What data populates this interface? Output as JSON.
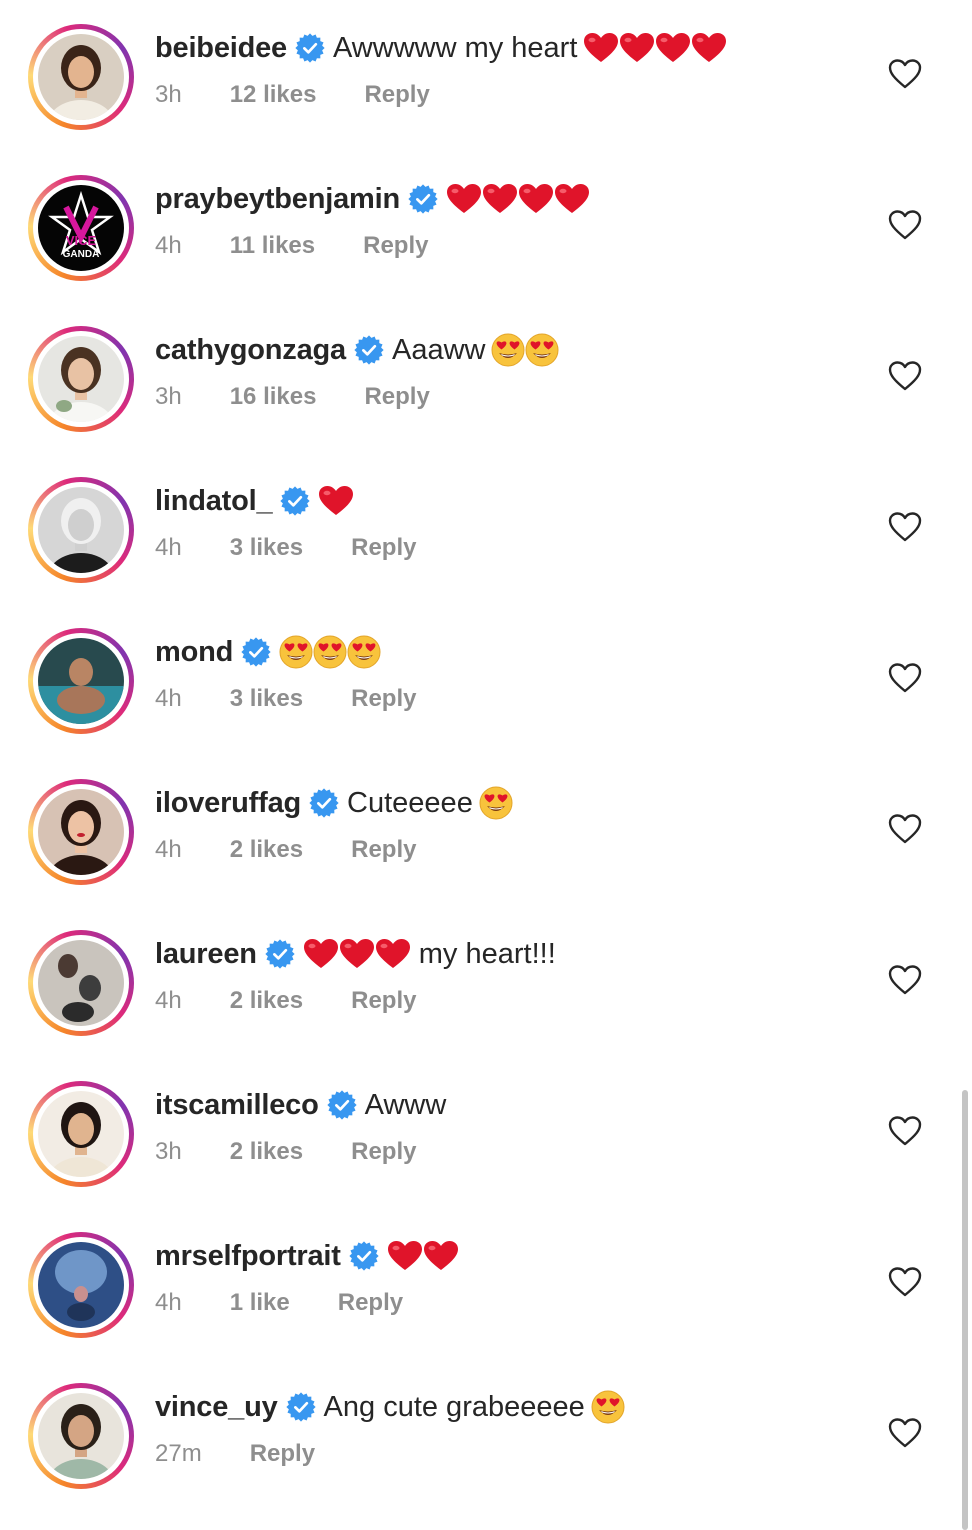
{
  "colors": {
    "username": "#262626",
    "meta": "#8e8e8e",
    "verified": "#3897f0",
    "heart_emoji": "#e0142a",
    "face_emoji": "#f8c33c"
  },
  "comments": [
    {
      "username": "beibeidee",
      "verified": true,
      "text_before": "Awwwww my heart",
      "emojis": [
        "heart",
        "heart",
        "heart",
        "heart"
      ],
      "text_after": "",
      "time": "3h",
      "likes": "12 likes",
      "reply": "Reply",
      "avatar": "portrait-woman-white-dress"
    },
    {
      "username": "praybeytbenjamin",
      "verified": true,
      "text_before": "",
      "emojis": [
        "heart",
        "heart",
        "heart",
        "heart"
      ],
      "text_after": "",
      "time": "4h",
      "likes": "11 likes",
      "reply": "Reply",
      "avatar": "vice-ganda-logo",
      "avatar_text": [
        "VICE",
        "GANDA"
      ]
    },
    {
      "username": "cathygonzaga",
      "verified": true,
      "text_before": "Aaaww",
      "emojis": [
        "heart-eyes",
        "heart-eyes"
      ],
      "text_after": "",
      "time": "3h",
      "likes": "16 likes",
      "reply": "Reply",
      "avatar": "portrait-bride"
    },
    {
      "username": "lindatol_",
      "verified": true,
      "text_before": "",
      "emojis": [
        "heart"
      ],
      "text_after": "",
      "time": "4h",
      "likes": "3 likes",
      "reply": "Reply",
      "avatar": "portrait-woman-black-white"
    },
    {
      "username": "mond",
      "verified": true,
      "text_before": "",
      "emojis": [
        "heart-eyes",
        "heart-eyes",
        "heart-eyes"
      ],
      "text_after": "",
      "time": "4h",
      "likes": "3 likes",
      "reply": "Reply",
      "avatar": "portrait-man-pool"
    },
    {
      "username": "iloveruffag",
      "verified": true,
      "text_before": "Cuteeeee",
      "emojis": [
        "heart-eyes"
      ],
      "text_after": "",
      "time": "4h",
      "likes": "2 likes",
      "reply": "Reply",
      "avatar": "portrait-woman-red-lips"
    },
    {
      "username": "laureen",
      "verified": true,
      "text_before": "",
      "emojis": [
        "heart",
        "heart",
        "heart"
      ],
      "text_after": "my heart!!!",
      "time": "4h",
      "likes": "2 likes",
      "reply": "Reply",
      "avatar": "portrait-collage"
    },
    {
      "username": "itscamilleco",
      "verified": true,
      "text_before": "Awww",
      "emojis": [],
      "text_after": "",
      "time": "3h",
      "likes": "2 likes",
      "reply": "Reply",
      "avatar": "portrait-woman-cream"
    },
    {
      "username": "mrselfportrait",
      "verified": true,
      "text_before": "",
      "emojis": [
        "heart",
        "heart"
      ],
      "text_after": "",
      "time": "4h",
      "likes": "1 like",
      "reply": "Reply",
      "avatar": "portrait-blue-light"
    },
    {
      "username": "vince_uy",
      "verified": true,
      "text_before": "Ang cute grabeeeee",
      "emojis": [
        "heart-eyes"
      ],
      "text_after": "",
      "time": "27m",
      "likes": "",
      "reply": "Reply",
      "avatar": "portrait-man-green"
    }
  ],
  "icons": {
    "verified": "verified-badge-icon",
    "like": "heart-outline-icon"
  }
}
